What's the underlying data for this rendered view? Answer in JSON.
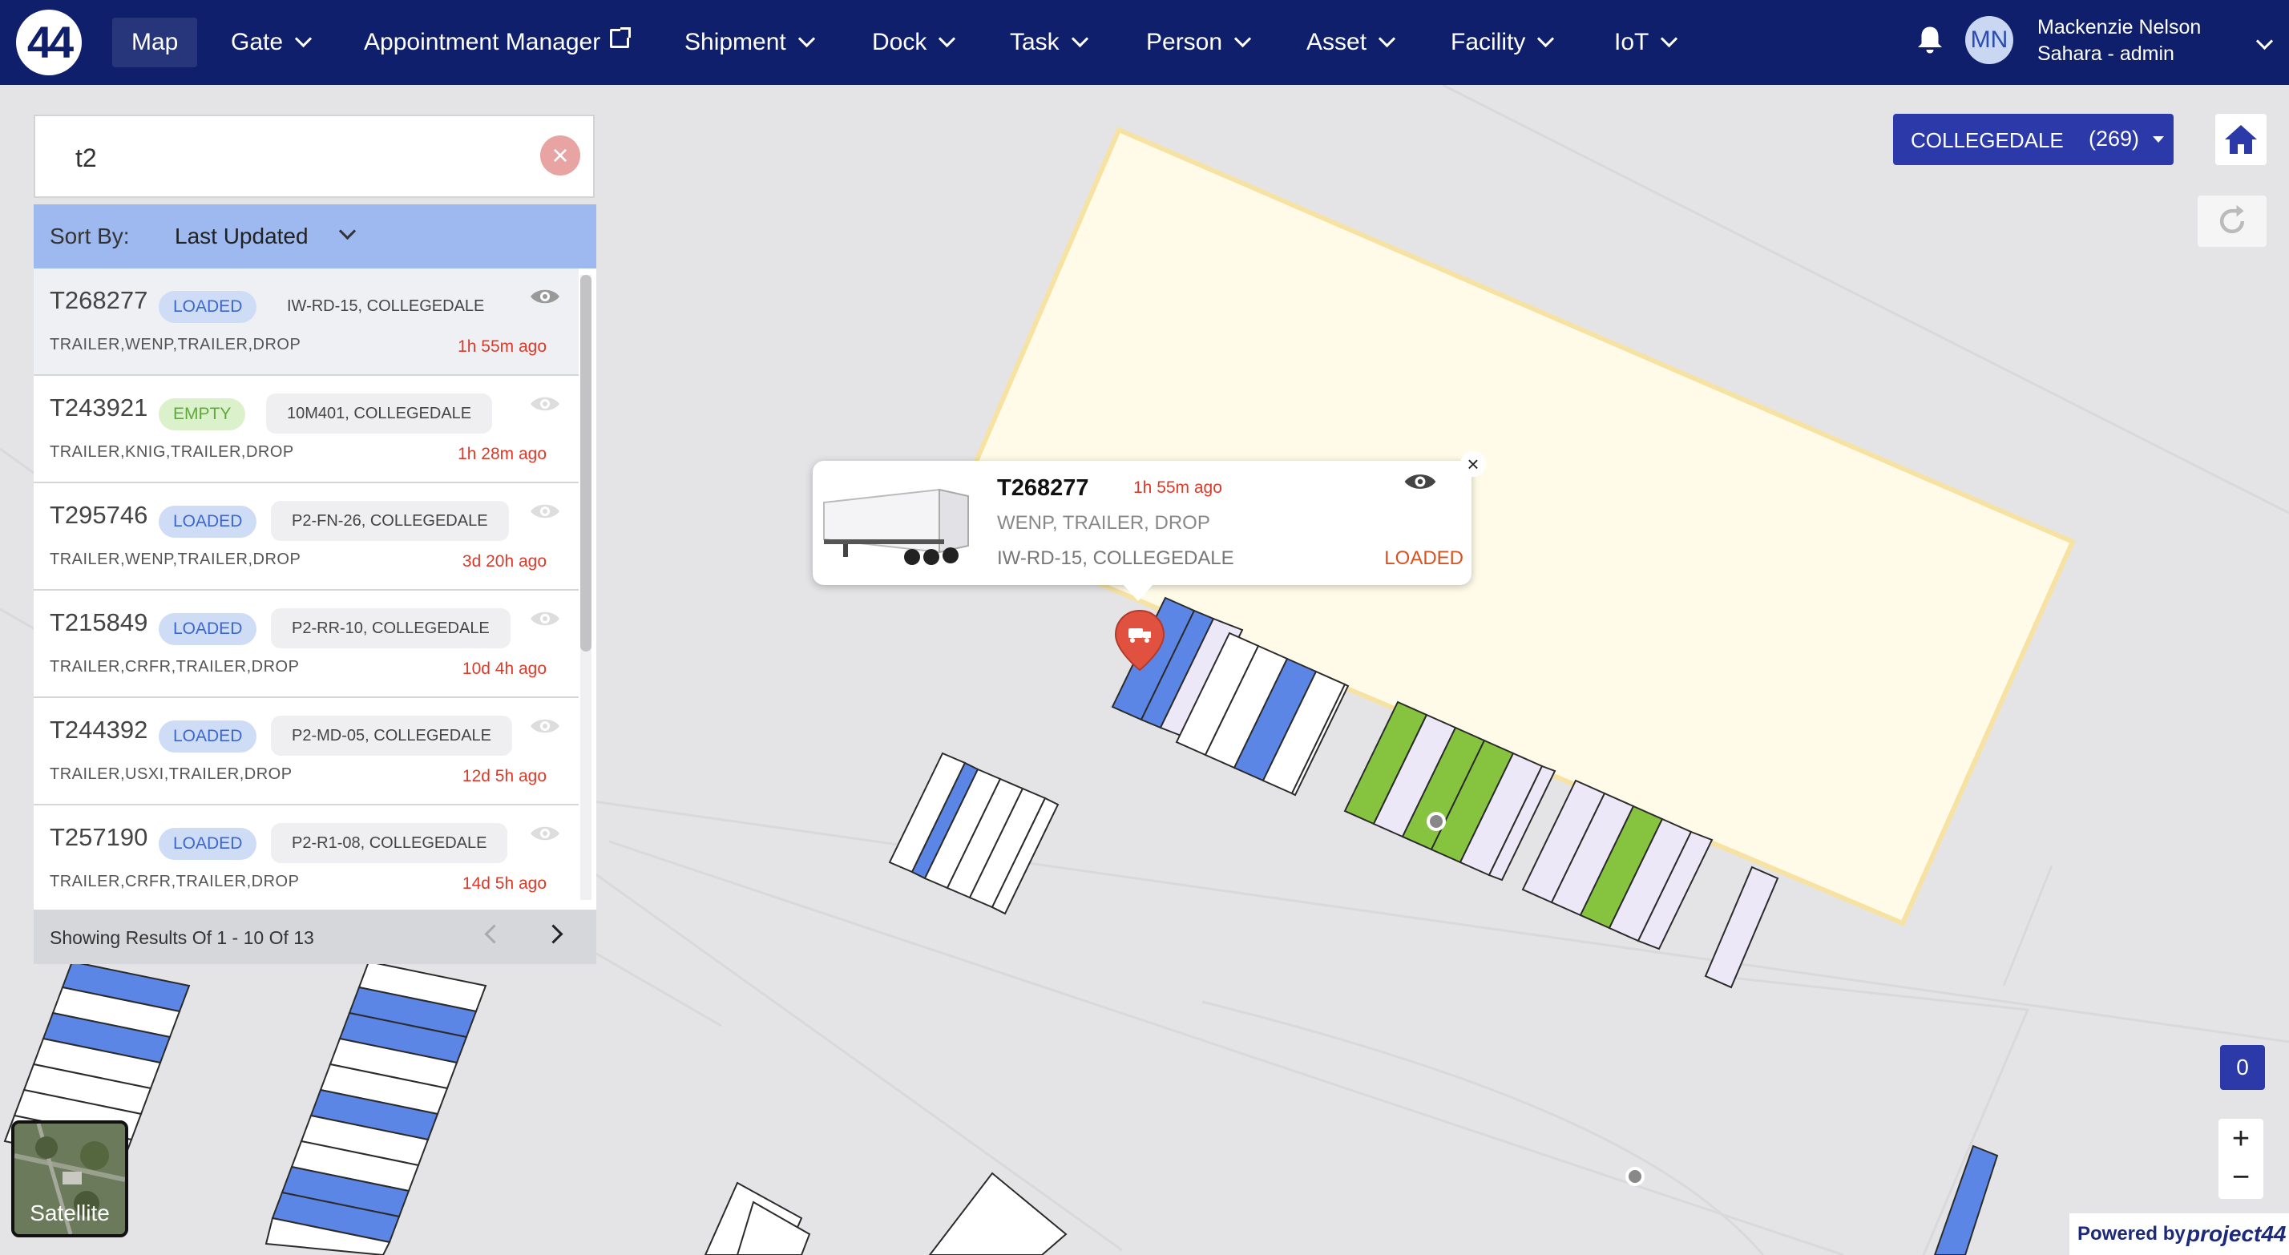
{
  "nav": {
    "logo": "44",
    "items": [
      {
        "label": "Map",
        "active": true,
        "chevron": false
      },
      {
        "label": "Gate",
        "chevron": true
      },
      {
        "label": "Appointment Manager",
        "external": true
      },
      {
        "label": "Shipment",
        "chevron": true
      },
      {
        "label": "Dock",
        "chevron": true
      },
      {
        "label": "Task",
        "chevron": true
      },
      {
        "label": "Person",
        "chevron": true
      },
      {
        "label": "Asset",
        "chevron": true
      },
      {
        "label": "Facility",
        "chevron": true
      },
      {
        "label": "IoT",
        "chevron": true
      }
    ],
    "user": {
      "initials": "MN",
      "name": "Mackenzie Nelson",
      "role": "Sahara - admin"
    },
    "icons": {
      "bell": "bell-icon",
      "user_menu": "chevron-down-icon"
    }
  },
  "search": {
    "value": "t2",
    "clear_icon": "close-icon"
  },
  "sort": {
    "label": "Sort By:",
    "value": "Last Updated"
  },
  "results": [
    {
      "id": "T268277",
      "status": "LOADED",
      "location_code": "IW-RD-15",
      "facility": "COLLEGEDALE",
      "types": "TRAILER,WENP,TRAILER,DROP",
      "time": "1h 55m ago",
      "selected": true
    },
    {
      "id": "T243921",
      "status": "EMPTY",
      "location_code": "10M401",
      "facility": "COLLEGEDALE",
      "types": "TRAILER,KNIG,TRAILER,DROP",
      "time": "1h 28m ago"
    },
    {
      "id": "T295746",
      "status": "LOADED",
      "location_code": "P2-FN-26",
      "facility": "COLLEGEDALE",
      "types": "TRAILER,WENP,TRAILER,DROP",
      "time": "3d 20h ago"
    },
    {
      "id": "T215849",
      "status": "LOADED",
      "location_code": "P2-RR-10",
      "facility": "COLLEGEDALE",
      "types": "TRAILER,CRFR,TRAILER,DROP",
      "time": "10d 4h ago"
    },
    {
      "id": "T244392",
      "status": "LOADED",
      "location_code": "P2-MD-05",
      "facility": "COLLEGEDALE",
      "types": "TRAILER,USXI,TRAILER,DROP",
      "time": "12d 5h ago"
    },
    {
      "id": "T257190",
      "status": "LOADED",
      "location_code": "P2-R1-08",
      "facility": "COLLEGEDALE",
      "types": "TRAILER,CRFR,TRAILER,DROP",
      "time": "14d 5h ago"
    }
  ],
  "pagination": {
    "text": "Showing Results Of 1 - 10 Of 13"
  },
  "popup": {
    "id": "T268277",
    "time": "1h 55m ago",
    "types": "WENP, TRAILER, DROP",
    "location": "IW-RD-15, COLLEGEDALE",
    "status": "LOADED"
  },
  "facility": {
    "name": "COLLEGEDALE",
    "count": "(269)"
  },
  "map_controls": {
    "count_badge": "0",
    "zoom_in": "+",
    "zoom_out": "−",
    "satellite": "Satellite"
  },
  "powered": {
    "text": "Powered by",
    "brand": "project44"
  },
  "colors": {
    "nav_bg": "#0f1f6b",
    "accent": "#2b3aa8",
    "loaded": "#3a68d0",
    "empty": "#5fa83a",
    "time": "#dd3a2a",
    "slot_blue": "#5b86e5",
    "slot_green": "#86c440",
    "slot_lavender": "#ece8f7",
    "facility_fill": "#fffbe8"
  }
}
